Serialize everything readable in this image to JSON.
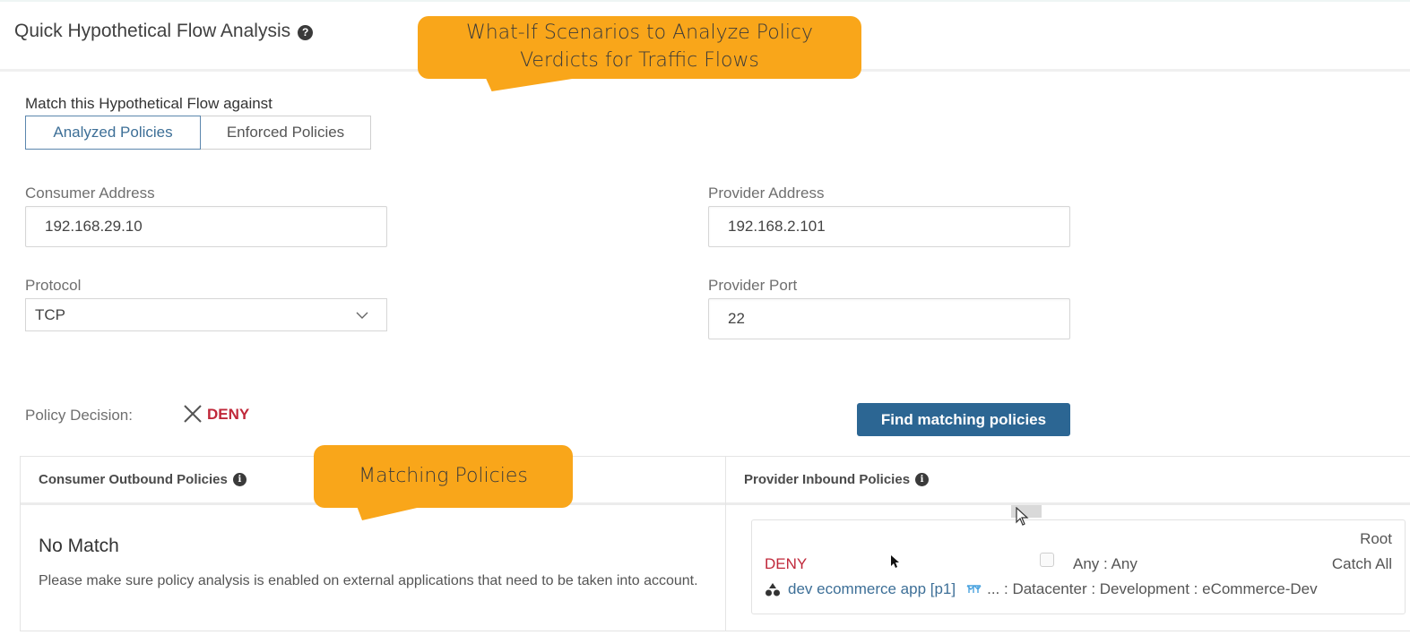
{
  "header": {
    "title": "Quick Hypothetical Flow Analysis",
    "help_icon": "question-circle-icon"
  },
  "annotations": {
    "top_callout": "What-If Scenarios to Analyze Policy Verdicts for Traffic Flows",
    "top_callout_line1": "What-If Scenarios to Analyze Policy",
    "top_callout_line2": "Verdicts for Traffic Flows",
    "bottom_callout": "Matching Policies",
    "color": "#f9a61a"
  },
  "match_against": {
    "label": "Match this Hypothetical Flow against",
    "options": [
      {
        "label": "Analyzed Policies",
        "selected": true
      },
      {
        "label": "Enforced Policies",
        "selected": false
      }
    ]
  },
  "form": {
    "consumer_address": {
      "label": "Consumer Address",
      "value": "192.168.29.10"
    },
    "provider_address": {
      "label": "Provider Address",
      "value": "192.168.2.101"
    },
    "protocol": {
      "label": "Protocol",
      "value": "TCP"
    },
    "provider_port": {
      "label": "Provider Port",
      "value": "22"
    }
  },
  "decision": {
    "label": "Policy Decision:",
    "value": "DENY",
    "icon": "x-icon",
    "color": "#c0283a"
  },
  "actions": {
    "find_label": "Find matching policies",
    "button_color": "#2c6693"
  },
  "consumer_outbound": {
    "title": "Consumer Outbound Policies",
    "info_icon": "info-icon",
    "info_glyph": "i",
    "no_match_title": "No Match",
    "no_match_text": "Please make sure policy analysis is enabled on external applications that need to be taken into account."
  },
  "provider_inbound": {
    "title": "Provider Inbound Policies",
    "info_icon": "info-icon",
    "info_glyph": "i",
    "policies": [
      {
        "action": "DENY",
        "ports": "Any : Any",
        "scope": "Root",
        "rule": "Catch All",
        "app": "dev ecommerce app [p1]",
        "scope_path": "... : Datacenter : Development : eCommerce-Dev"
      }
    ]
  },
  "help_glyph": "?"
}
